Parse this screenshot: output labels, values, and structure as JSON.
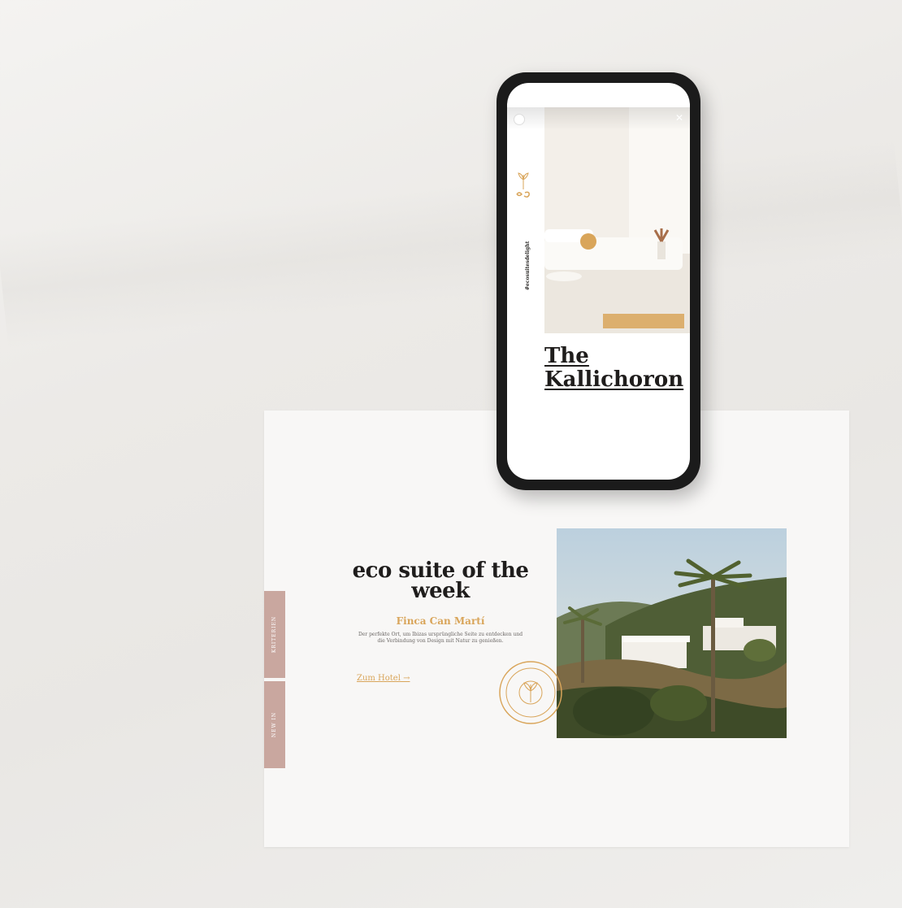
{
  "colors": {
    "accent_gold": "#d9a55a",
    "side_tab": "#c9a79f",
    "heading_dark": "#1f1d1c",
    "card_bg": "#f8f7f6"
  },
  "desktop": {
    "side_tabs": [
      "KRITERIEN",
      "NEW IN"
    ],
    "headline": "eco suite of the week",
    "subhead": "Finca Can Martí",
    "body": "Der perfekte Ort, um Ibizas ursprüngliche Seite zu entdecken und die Verbindung von Design mit Natur zu genießen.",
    "cta": "Zum Hotel →",
    "photo_icon": "villa-palm-photo",
    "stamp_icon": "eco-seal-icon"
  },
  "phone": {
    "story_icon": "interior-room-photo",
    "logo_icon": "es-plant-logo-icon",
    "hashtag": "#ecosuitesdelight",
    "title_line1": "The",
    "title_line2": "Kallichoron",
    "close_icon": "close-icon"
  }
}
